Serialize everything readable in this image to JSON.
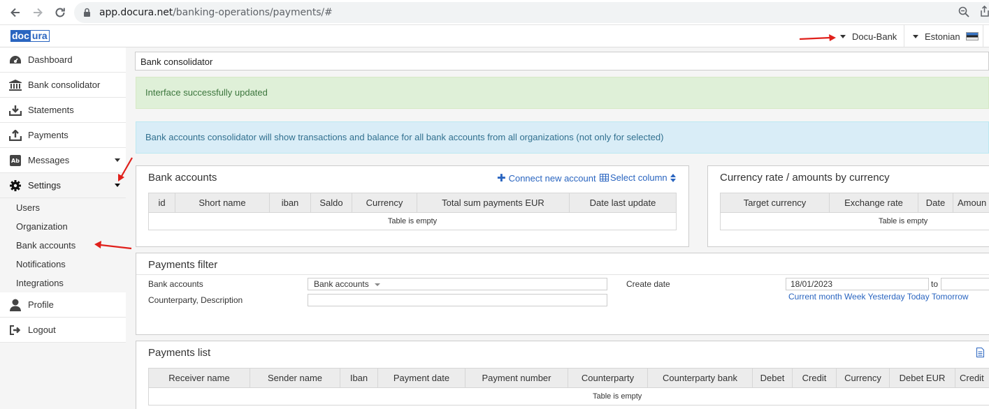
{
  "browser": {
    "url_host": "app.docura.net",
    "url_path": "/banking-operations/payments/#"
  },
  "header": {
    "logo_left": "doc",
    "logo_right": "ura",
    "company": "Docu-Bank",
    "language": "Estonian"
  },
  "sidebar": {
    "items": [
      {
        "label": "Dashboard",
        "icon": "dashboard-icon"
      },
      {
        "label": "Bank consolidator",
        "icon": "bank-icon"
      },
      {
        "label": "Statements",
        "icon": "download-icon"
      },
      {
        "label": "Payments",
        "icon": "upload-icon"
      },
      {
        "label": "Messages",
        "icon": "messages-icon"
      },
      {
        "label": "Settings",
        "icon": "gear-icon"
      }
    ],
    "settings_sub": [
      "Users",
      "Organization",
      "Bank accounts",
      "Notifications",
      "Integrations"
    ],
    "bottom_items": [
      {
        "label": "Profile",
        "icon": "user-icon"
      },
      {
        "label": "Logout",
        "icon": "logout-icon"
      }
    ]
  },
  "main": {
    "breadcrumb": "Bank consolidator",
    "success_alert": "Interface successfully updated",
    "info_alert": "Bank accounts consolidator will show transactions and balance for all bank accounts from all organizations (not only for selected)",
    "bank_accounts": {
      "title": "Bank accounts",
      "connect_label": "Connect new account",
      "select_column_label": "Select column",
      "columns": [
        "id",
        "Short name",
        "iban",
        "Saldo",
        "Currency",
        "Total sum payments EUR",
        "Date last update"
      ],
      "empty_text": "Table is empty"
    },
    "currency_rate": {
      "title": "Currency rate / amounts by currency",
      "columns": [
        "Target currency",
        "Exchange rate",
        "Date",
        "Amoun"
      ],
      "empty_text": "Table is empty"
    },
    "payments_filter": {
      "title": "Payments filter",
      "bank_accounts_label": "Bank accounts",
      "bank_accounts_value": "Bank accounts",
      "counterparty_label": "Counterparty, Description",
      "counterparty_value": "",
      "create_date_label": "Create date",
      "date_from": "18/01/2023",
      "to_label": "to",
      "date_to": "",
      "quick_dates": [
        "Current month",
        "Week",
        "Yesterday",
        "Today",
        "Tomorrow"
      ]
    },
    "payments_list": {
      "title": "Payments list",
      "columns": [
        "Receiver name",
        "Sender name",
        "Iban",
        "Payment date",
        "Payment number",
        "Counterparty",
        "Counterparty bank",
        "Debet",
        "Credit",
        "Currency",
        "Debet EUR",
        "Credit"
      ],
      "empty_text": "Table is empty"
    }
  },
  "colors": {
    "accent": "#2a65c0",
    "annotation": "#e0201b",
    "success_bg": "#dff0d8",
    "info_bg": "#d9edf7"
  }
}
